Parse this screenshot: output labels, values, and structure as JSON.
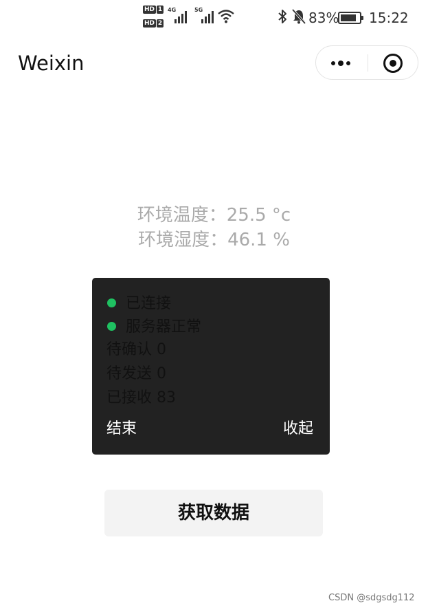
{
  "status_bar": {
    "hd_label": "HD",
    "sim1": "1",
    "sim2": "2",
    "net1": "4G",
    "net2": "5G",
    "battery_level": 0.83,
    "battery_percent": "83%",
    "time": "15:22",
    "icons": [
      "signal-icon",
      "wifi-icon",
      "bluetooth-icon",
      "mute-icon",
      "battery-icon"
    ]
  },
  "nav": {
    "title": "Weixin",
    "more_icon": "more-icon",
    "close_icon": "close-target-icon"
  },
  "readings": {
    "temperature": "环境温度：25.5 °c",
    "humidity": "环境湿度：46.1 %"
  },
  "panel": {
    "status_connected": "已连接",
    "status_server": "服务器正常",
    "pending_confirm": "待确认 0",
    "pending_send": "待发送 0",
    "received": "已接收 83",
    "end_label": "结束",
    "collapse_label": "收起",
    "dot_color": "#1fc161"
  },
  "button": {
    "label": "获取数据"
  },
  "watermark": "CSDN @sdgsdg112"
}
